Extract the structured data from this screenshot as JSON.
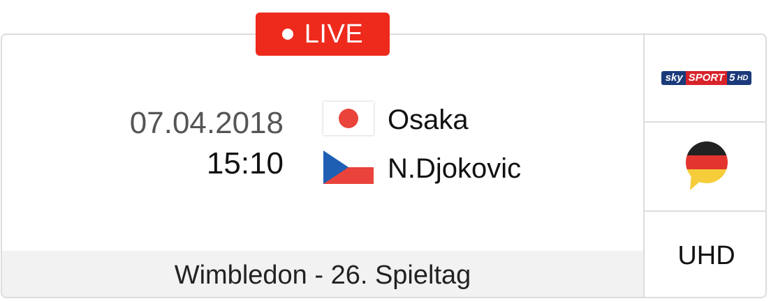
{
  "live_badge": {
    "label": "LIVE",
    "color": "#ee2a1c"
  },
  "match": {
    "date": "07.04.2018",
    "time": "15:10",
    "players": [
      {
        "name": "Osaka",
        "flag": "japan-flag-icon"
      },
      {
        "name": "N.Djokovic",
        "flag": "czech-flag-icon"
      }
    ],
    "competition": "Wimbledon - 26. Spieltag"
  },
  "broadcast": {
    "channel_logo": {
      "parts": [
        "sky",
        "SPORT",
        "5",
        "HD"
      ],
      "icon": "sky-sport-5-hd-logo"
    },
    "language_icon": "german-flag-speech-bubble-icon",
    "quality": "UHD"
  }
}
